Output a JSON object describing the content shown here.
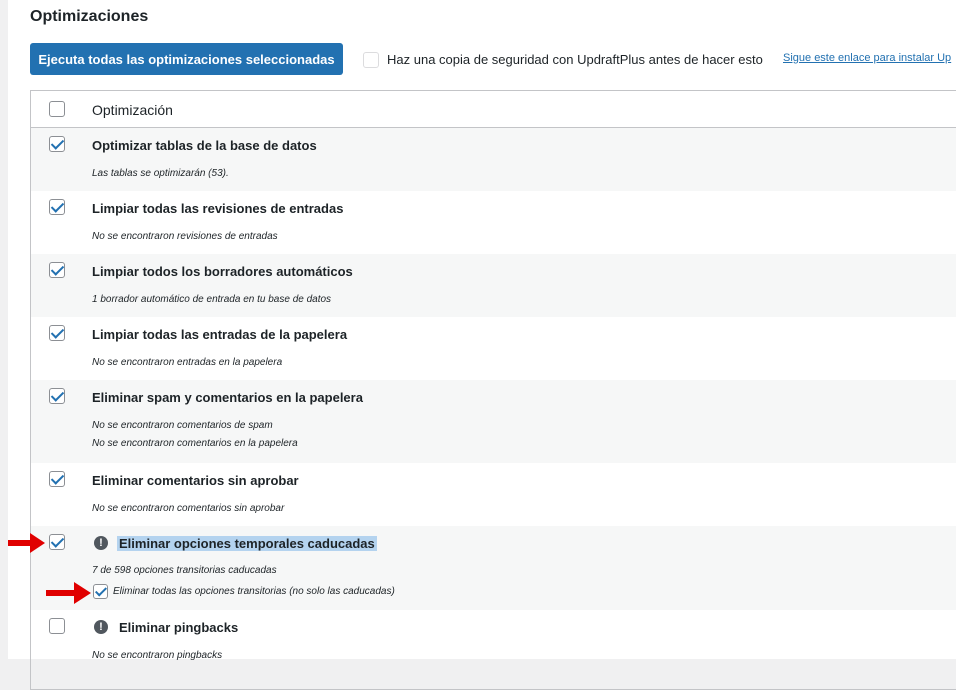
{
  "page": {
    "title": "Optimizaciones",
    "run_button": "Ejecuta todas las optimizaciones seleccionadas",
    "backup_label": "Haz una copia de seguridad con UpdraftPlus antes de hacer esto",
    "backup_link": "Sigue este enlace para instalar Up"
  },
  "table": {
    "header": "Optimización",
    "rows": [
      {
        "name": "Optimizar tablas de la base de datos",
        "info": [
          "Las tablas se optimizarán (53)."
        ],
        "checked": true
      },
      {
        "name": "Limpiar todas las revisiones de entradas",
        "info": [
          "No se encontraron revisiones de entradas"
        ],
        "checked": true
      },
      {
        "name": "Limpiar todos los borradores automáticos",
        "info": [
          "1 borrador automático de entrada en tu base de datos"
        ],
        "checked": true
      },
      {
        "name": "Limpiar todas las entradas de la papelera",
        "info": [
          "No se encontraron entradas en la papelera"
        ],
        "checked": true
      },
      {
        "name": "Eliminar spam y comentarios en la papelera",
        "info": [
          "No se encontraron comentarios de spam",
          "No se encontraron comentarios en la papelera"
        ],
        "checked": true
      },
      {
        "name": "Eliminar comentarios sin aprobar",
        "info": [
          "No se encontraron comentarios sin aprobar"
        ],
        "checked": true
      },
      {
        "name": "Eliminar opciones temporales caducadas",
        "info": [
          "7 de 598 opciones transitorias caducadas"
        ],
        "checked": true,
        "warning": true,
        "sub_option": "Eliminar todas las opciones transitorias (no solo las caducadas)"
      },
      {
        "name": "Eliminar pingbacks",
        "info": [
          "No se encontraron pingbacks"
        ],
        "checked": false,
        "warning": true
      }
    ]
  },
  "icons": {
    "warning": "exclamation-circle-icon",
    "arrow": "red-arrow-icon"
  },
  "colors": {
    "primary": "#2271b1",
    "arrow": "#e00000",
    "highlight": "#b4d3ef"
  }
}
